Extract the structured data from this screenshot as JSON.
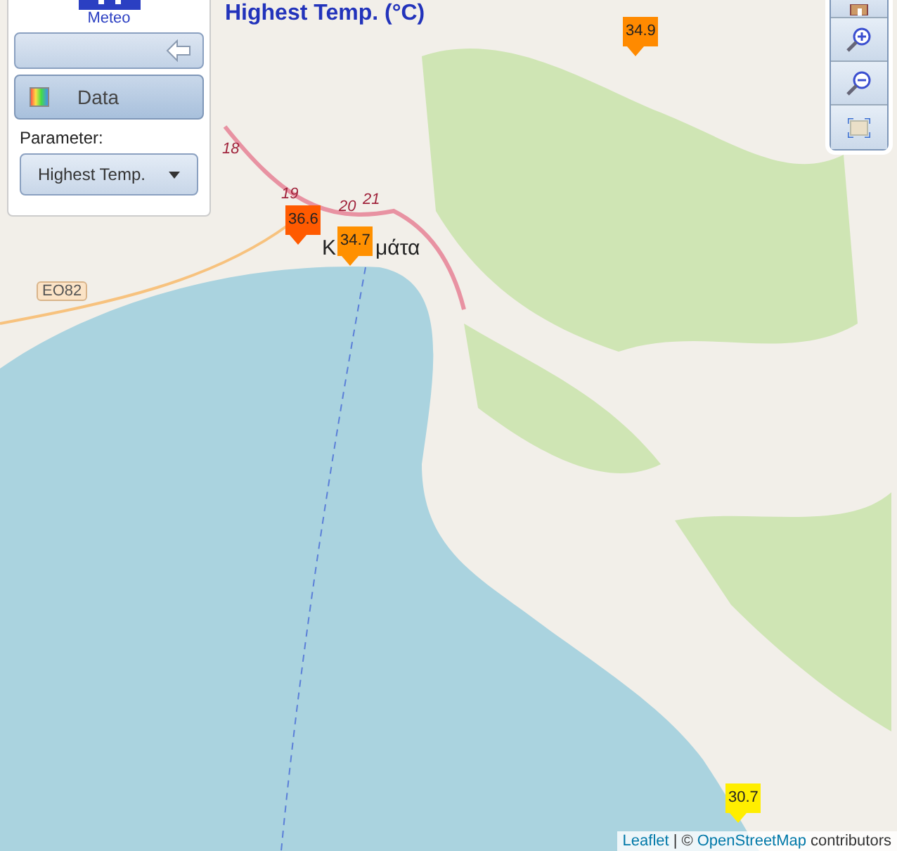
{
  "map_title": "Highest Temp. (°C)",
  "panel": {
    "logo_text": "Meteo",
    "section": {
      "label": "Data",
      "expanded": true
    },
    "parameter_label": "Parameter:",
    "parameter_value": "Highest Temp."
  },
  "map_labels": [
    {
      "kind": "road",
      "text": "18"
    },
    {
      "kind": "road",
      "text": "19"
    },
    {
      "kind": "road",
      "text": "20"
    },
    {
      "kind": "road",
      "text": "21"
    },
    {
      "kind": "place",
      "text": "Κ"
    },
    {
      "kind": "place",
      "text": "μάτα"
    },
    {
      "kind": "shield",
      "text": "EO82"
    }
  ],
  "markers": [
    {
      "value": "34.9",
      "color": "#ff8a00"
    },
    {
      "value": "36.6",
      "color": "#ff5a00"
    },
    {
      "value": "34.7",
      "color": "#ff9000"
    },
    {
      "value": "30.7",
      "color": "#ffee00"
    }
  ],
  "attribution": {
    "link1": "Leaflet",
    "separator": "| ©",
    "link2": "OpenStreetMap",
    "suffix": "contributors"
  }
}
